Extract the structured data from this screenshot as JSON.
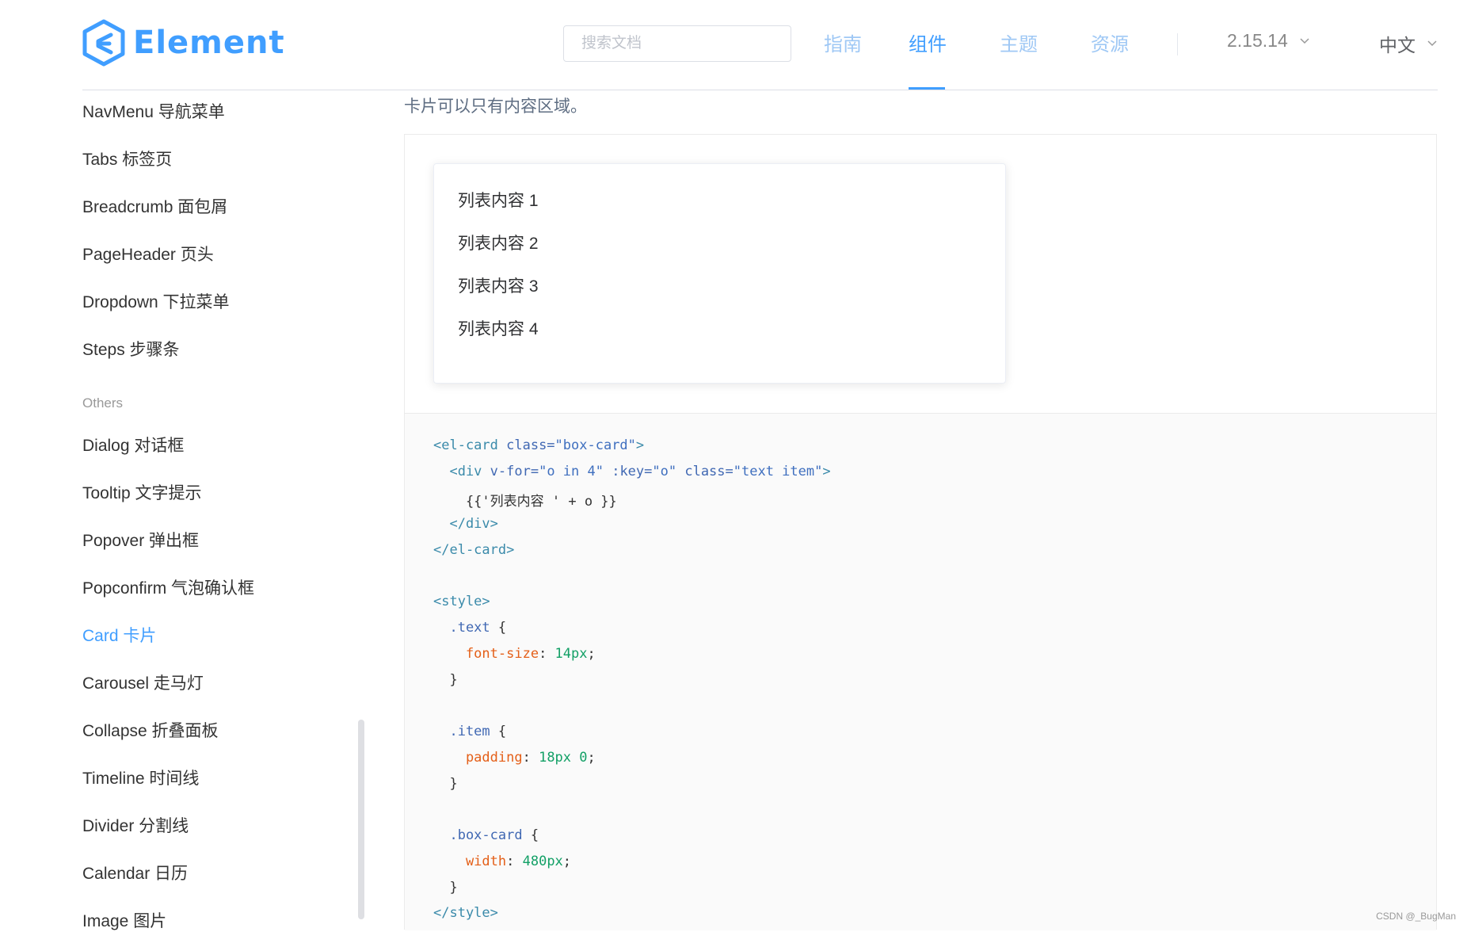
{
  "header": {
    "logo_text": "Element",
    "search_placeholder": "搜索文档",
    "nav": [
      "指南",
      "组件",
      "主题",
      "资源"
    ],
    "active_nav": "组件",
    "version": "2.15.14",
    "language": "中文"
  },
  "sidebar": {
    "items_top": [
      "NavMenu 导航菜单",
      "Tabs 标签页",
      "Breadcrumb 面包屑",
      "PageHeader 页头",
      "Dropdown 下拉菜单",
      "Steps 步骤条"
    ],
    "group_label": "Others",
    "items_others": [
      "Dialog 对话框",
      "Tooltip 文字提示",
      "Popover 弹出框",
      "Popconfirm 气泡确认框",
      "Card 卡片",
      "Carousel 走马灯",
      "Collapse 折叠面板",
      "Timeline 时间线",
      "Divider 分割线",
      "Calendar 日历",
      "Image 图片"
    ],
    "active_item": "Card 卡片"
  },
  "content": {
    "description": "卡片可以只有内容区域。",
    "card_items": [
      "列表内容 1",
      "列表内容 2",
      "列表内容 3",
      "列表内容 4"
    ],
    "code": {
      "l1_tag_open": "<el-card",
      "l1_attr": " class=",
      "l1_val": "\"box-card\"",
      "l1_close": ">",
      "l2_tag_open": "  <div",
      "l2_attr1": " v-for=",
      "l2_val1": "\"o in 4\"",
      "l2_attr2": " :key=",
      "l2_val2": "\"o\"",
      "l2_attr3": " class=",
      "l2_val3": "\"text item\"",
      "l2_close": ">",
      "l3": "    {{'列表内容 ' + o }}",
      "l4": "  </div>",
      "l5": "</el-card>",
      "l6": "<style>",
      "l7_sel": "  .text",
      "l7_brace": " {",
      "l8_prop": "    font-size",
      "l8_colon": ": ",
      "l8_val": "14px",
      "l8_semi": ";",
      "l9": "  }",
      "l10_sel": "  .item",
      "l10_brace": " {",
      "l11_prop": "    padding",
      "l11_colon": ": ",
      "l11_val": "18px 0",
      "l11_semi": ";",
      "l12": "  }",
      "l13_sel": "  .box-card",
      "l13_brace": " {",
      "l14_prop": "    width",
      "l14_colon": ": ",
      "l14_val": "480px",
      "l14_semi": ";",
      "l15": "  }",
      "l16": "</style>"
    }
  },
  "watermark": "CSDN @_BugMan",
  "colors": {
    "accent": "#409eff",
    "nav_inactive": "#9fc8f5"
  }
}
